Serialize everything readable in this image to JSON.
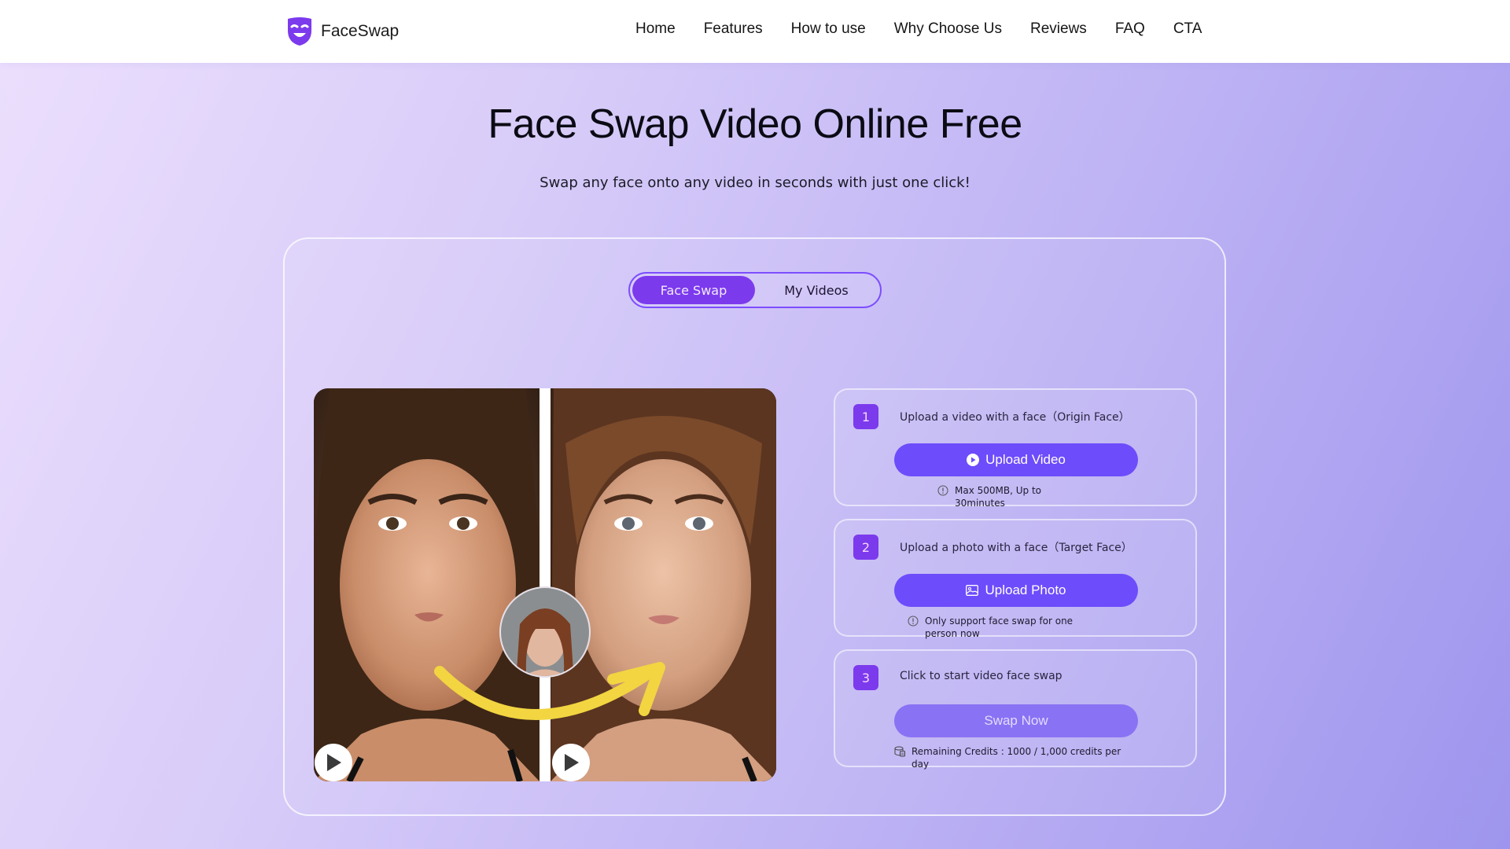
{
  "header": {
    "logo_text": "FaceSwap",
    "logo_icon": "theater-mask-icon",
    "brand_color": "#7c3aed",
    "nav": [
      "Home",
      "Features",
      "How to use",
      "Why Choose Us",
      "Reviews",
      "FAQ",
      "CTA"
    ]
  },
  "hero": {
    "title": "Face Swap Video Online Free",
    "subtitle": "Swap any face onto any video in seconds with just one click!"
  },
  "tabs": [
    {
      "label": "Face Swap",
      "active": true
    },
    {
      "label": "My Videos",
      "active": false
    }
  ],
  "preview": {
    "description": "Before/after face swap comparison with target face thumbnail and yellow arrow",
    "play_icons": 2
  },
  "steps": [
    {
      "number": "1",
      "title": "Upload a video with a face（Origin Face）",
      "button": "Upload Video",
      "button_icon": "play-circle-icon",
      "note_icon": "info-icon",
      "note": "Max 500MB, Up to 30minutes"
    },
    {
      "number": "2",
      "title": "Upload a photo with a face（Target Face）",
      "button": "Upload Photo",
      "button_icon": "image-icon",
      "note_icon": "info-icon",
      "note": "Only support face swap for one person now"
    },
    {
      "number": "3",
      "title": "Click to start video face swap",
      "button": "Swap Now",
      "button_disabled": true,
      "note_icon": "database-coins-icon",
      "note": "Remaining Credits : 1000 / 1,000 credits per day"
    }
  ]
}
